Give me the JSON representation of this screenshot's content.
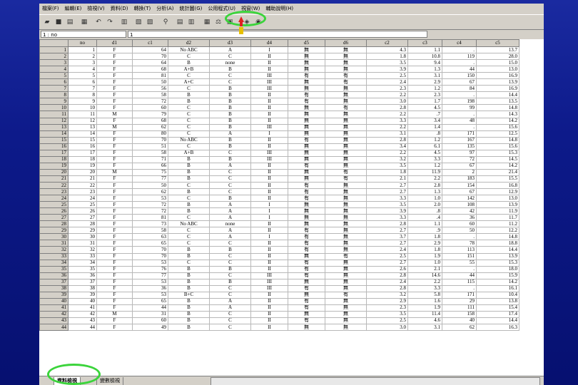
{
  "menu": [
    "檔案(F)",
    "編輯(E)",
    "檢視(V)",
    "資料(D)",
    "轉換(T)",
    "分析(A)",
    "統計圖(G)",
    "公用程式(U)",
    "視窗(W)",
    "輔助說明(H)"
  ],
  "cell_ref": "1 : no",
  "cell_value": "1",
  "columns": [
    "no",
    "d1",
    "c1",
    "d2",
    "d3",
    "d4",
    "d5",
    "d6",
    "c2",
    "c3",
    "c4",
    "c5"
  ],
  "rows": [
    [
      "1",
      "F",
      "64",
      "No ABC",
      "A",
      "I",
      "無",
      "無",
      "4.3",
      "1.1",
      ".",
      "13.7"
    ],
    [
      "2",
      "F",
      "70",
      "C",
      "C",
      "II",
      "無",
      "無",
      "1.8",
      "10.8",
      "119",
      "28.0"
    ],
    [
      "3",
      "F",
      "64",
      "B",
      "none",
      "II",
      "無",
      "無",
      "3.5",
      "9.4",
      ".",
      "15.0"
    ],
    [
      "4",
      "F",
      "68",
      "A+B",
      "B",
      "II",
      "無",
      "無",
      "3.9",
      "1.3",
      "44",
      "13.0"
    ],
    [
      "5",
      "F",
      "81",
      "C",
      "C",
      "III",
      "有",
      "有",
      "2.5",
      "3.1",
      "150",
      "16.9"
    ],
    [
      "6",
      "F",
      "50",
      "A+C",
      "C",
      "III",
      "無",
      "有",
      "2.4",
      "2.9",
      "67",
      "13.9"
    ],
    [
      "7",
      "F",
      "56",
      "C",
      "B",
      "III",
      "無",
      "無",
      "2.3",
      "1.2",
      "84",
      "16.9"
    ],
    [
      "8",
      "F",
      "58",
      "B",
      "B",
      "II",
      "有",
      "無",
      "2.2",
      "2.3",
      ".",
      "14.4"
    ],
    [
      "9",
      "F",
      "72",
      "B",
      "B",
      "II",
      "有",
      "無",
      "3.0",
      "1.7",
      "198",
      "13.5"
    ],
    [
      "10",
      "F",
      "60",
      "C",
      "B",
      "II",
      "無",
      "有",
      "2.8",
      "4.5",
      "99",
      "14.8"
    ],
    [
      "11",
      "M",
      "79",
      "C",
      "B",
      "II",
      "無",
      "無",
      "2.2",
      ".7",
      ".",
      "14.3"
    ],
    [
      "12",
      "F",
      "68",
      "C",
      "B",
      "II",
      "無",
      "無",
      "3.3",
      "3.4",
      "48",
      "14.2"
    ],
    [
      "13",
      "M",
      "62",
      "C",
      "B",
      "III",
      "無",
      "無",
      "2.2",
      "1.4",
      ".",
      "15.6"
    ],
    [
      "14",
      "F",
      "80",
      "C",
      "A",
      "I",
      "無",
      "無",
      "3.1",
      ".8",
      "171",
      "12.5"
    ],
    [
      "15",
      "F",
      "70",
      "No ABC",
      "B",
      "II",
      "有",
      "無",
      "2.8",
      "1.2",
      "167",
      "14.8"
    ],
    [
      "16",
      "F",
      "51",
      "C",
      "B",
      "II",
      "無",
      "無",
      "3.4",
      "6.1",
      "135",
      "15.6"
    ],
    [
      "17",
      "F",
      "58",
      "A+B",
      "C",
      "III",
      "無",
      "無",
      "2.2",
      "4.5",
      "97",
      "15.3"
    ],
    [
      "18",
      "F",
      "71",
      "B",
      "B",
      "III",
      "無",
      "無",
      "3.2",
      "3.3",
      "72",
      "14.5"
    ],
    [
      "19",
      "F",
      "66",
      "B",
      "A",
      "II",
      "有",
      "無",
      "3.5",
      "1.2",
      "67",
      "14.2"
    ],
    [
      "20",
      "M",
      "75",
      "B",
      "C",
      "II",
      "無",
      "有",
      "1.8",
      "11.9",
      "2",
      "21.4"
    ],
    [
      "21",
      "F",
      "77",
      "B",
      "C",
      "II",
      "無",
      "有",
      "2.1",
      "2.2",
      "183",
      "15.5"
    ],
    [
      "22",
      "F",
      "50",
      "C",
      "C",
      "II",
      "有",
      "無",
      "2.7",
      "2.8",
      "154",
      "16.8"
    ],
    [
      "23",
      "F",
      "62",
      "B",
      "C",
      "II",
      "有",
      "無",
      "2.7",
      "1.3",
      "67",
      "12.9"
    ],
    [
      "24",
      "F",
      "53",
      "C",
      "B",
      "II",
      "有",
      "無",
      "3.3",
      "1.0",
      "142",
      "13.0"
    ],
    [
      "25",
      "F",
      "72",
      "B",
      "A",
      "I",
      "無",
      "無",
      "3.5",
      "2.0",
      "108",
      "13.9"
    ],
    [
      "26",
      "F",
      "72",
      "B",
      "A",
      "I",
      "無",
      "無",
      "3.9",
      ".8",
      "42",
      "11.9"
    ],
    [
      "27",
      "F",
      "81",
      "C",
      "A",
      "I",
      "無",
      "無",
      "3.3",
      ".4",
      "36",
      "11.7"
    ],
    [
      "28",
      "F",
      "73",
      "No ABC",
      "none",
      "II",
      "無",
      "無",
      "2.8",
      "1.1",
      "60",
      "11.2"
    ],
    [
      "29",
      "F",
      "58",
      "C",
      "A",
      "II",
      "有",
      "無",
      "2.7",
      ".9",
      "50",
      "12.2"
    ],
    [
      "30",
      "F",
      "63",
      "C",
      "A",
      "I",
      "有",
      "無",
      "3.7",
      "1.8",
      ".",
      "14.8"
    ],
    [
      "31",
      "F",
      "65",
      "C",
      "C",
      "II",
      "有",
      "無",
      "2.7",
      "2.9",
      "78",
      "18.8"
    ],
    [
      "32",
      "F",
      "70",
      "B",
      "B",
      "II",
      "有",
      "無",
      "2.4",
      "1.8",
      "113",
      "14.4"
    ],
    [
      "33",
      "F",
      "70",
      "B",
      "C",
      "II",
      "無",
      "有",
      "2.5",
      "1.9",
      "151",
      "13.9"
    ],
    [
      "34",
      "F",
      "53",
      "C",
      "C",
      "II",
      "有",
      "無",
      "2.7",
      "1.0",
      "55",
      "15.3"
    ],
    [
      "35",
      "F",
      "76",
      "B",
      "B",
      "II",
      "有",
      "無",
      "2.6",
      "2.1",
      ".",
      "18.0"
    ],
    [
      "36",
      "F",
      "77",
      "B",
      "C",
      "III",
      "有",
      "無",
      "2.8",
      "14.6",
      "44",
      "15.9"
    ],
    [
      "37",
      "F",
      "53",
      "B",
      "B",
      "III",
      "無",
      "無",
      "2.4",
      "2.2",
      "115",
      "14.2"
    ],
    [
      "38",
      "F",
      "36",
      "B",
      "C",
      "III",
      "有",
      "無",
      "2.8",
      "3.3",
      ".",
      "16.1"
    ],
    [
      "39",
      "F",
      "53",
      "B+C",
      "C",
      "II",
      "無",
      "有",
      "3.2",
      "5.8",
      "171",
      "10.4"
    ],
    [
      "40",
      "F",
      "65",
      "B",
      "A",
      "II",
      "有",
      "無",
      "2.9",
      "1.6",
      "29",
      "13.8"
    ],
    [
      "41",
      "F",
      "44",
      "B",
      "A",
      "II",
      "有",
      "無",
      "2.3",
      "1.9",
      "111",
      "15.4"
    ],
    [
      "42",
      "M",
      "31",
      "B",
      "C",
      "II",
      "無",
      "無",
      "3.5",
      "11.4",
      "158",
      "17.4"
    ],
    [
      "43",
      "F",
      "60",
      "B",
      "C",
      "II",
      "有",
      "無",
      "2.5",
      "4.6",
      "40",
      "14.4"
    ],
    [
      "44",
      "F",
      "49",
      "B",
      "C",
      "II",
      "無",
      "無",
      "3.0",
      "3.1",
      "62",
      "16.3"
    ]
  ],
  "tabs": {
    "data_view": "資料檢視",
    "variable_view": "變數檢視"
  },
  "icons": [
    "open-folder-icon",
    "save-icon",
    "print-icon",
    "dialog-recall-icon",
    "undo-icon",
    "redo-icon",
    "goto-chart-icon",
    "goto-case-icon",
    "variables-icon",
    "find-icon",
    "insert-case-icon",
    "insert-variable-icon",
    "split-file-icon",
    "weight-cases-icon",
    "select-cases-icon",
    "value-labels-icon",
    "use-sets-icon"
  ],
  "highlight_color": "#3bd43b"
}
